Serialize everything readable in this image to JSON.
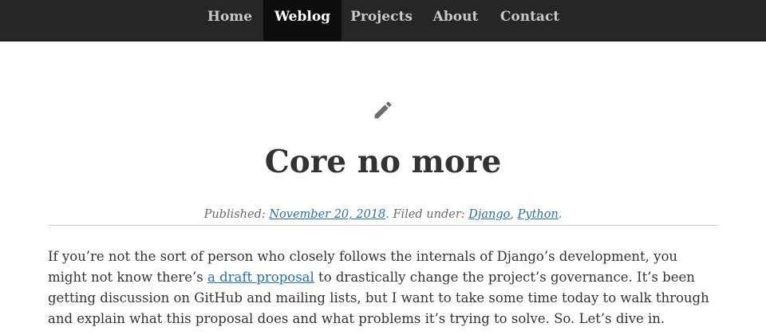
{
  "nav": {
    "items": [
      "Home",
      "Weblog",
      "Projects",
      "About",
      "Contact"
    ],
    "active": "Weblog"
  },
  "post": {
    "icon": "pencil-icon",
    "title": "Core no more",
    "meta": {
      "published_label": "Published: ",
      "date": "November 20, 2018",
      "filed_label": ". Filed under: ",
      "category_1": "Django",
      "separator": ", ",
      "category_2": "Python",
      "end": "."
    },
    "body": {
      "line1": "If you’re not the sort of person who closely follows the internals of Django’s development, you",
      "line2_before": "might not know there’s ",
      "line2_link": "a draft proposal",
      "line2_after": " to drastically change the project’s governance. It’s been",
      "line3": "getting discussion on GitHub and mailing lists, but I want to take some time today to walk through",
      "line4": "and explain what this proposal does and what problems it’s trying to solve. So. Let’s dive in."
    }
  },
  "colors": {
    "nav_bg": "#262626",
    "nav_active_bg": "#0d0d0d",
    "link": "#2a6fa8",
    "text": "#333333"
  }
}
